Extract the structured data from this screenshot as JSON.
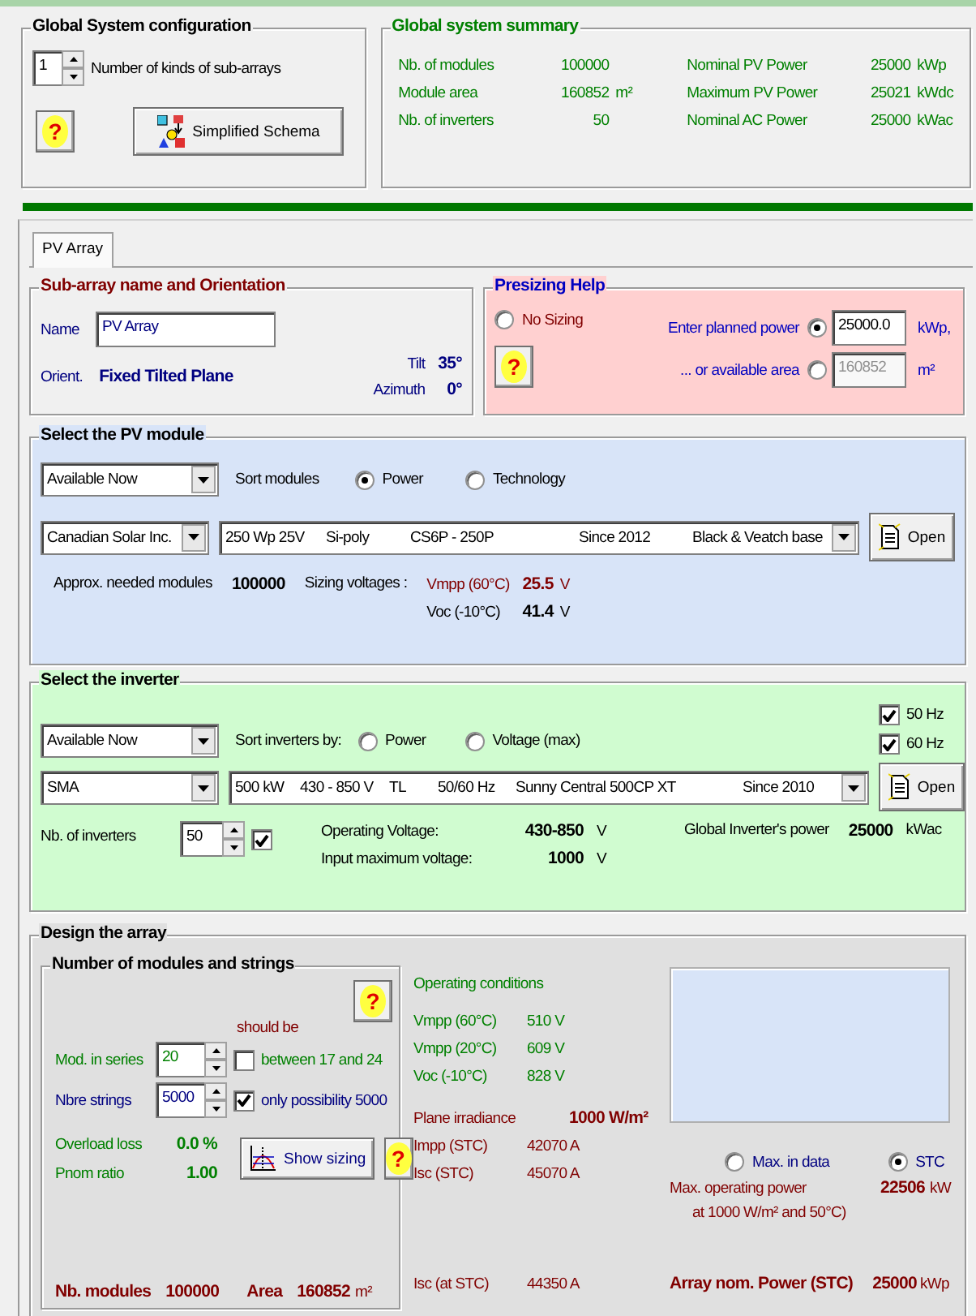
{
  "config": {
    "title": "Global System configuration",
    "subarray_count": "1",
    "subarray_label": "Number of kinds of sub-arrays",
    "help": "?",
    "schema_button": "Simplified Schema"
  },
  "summary": {
    "title": "Global system summary",
    "rows": [
      {
        "left": {
          "label": "Nb. of modules",
          "value": "100000"
        },
        "right": {
          "label": "Nominal PV Power",
          "value": "25000",
          "unit": "kWp"
        }
      },
      {
        "left": {
          "label": "Module area",
          "value": "160852",
          "unit": "m²"
        },
        "right": {
          "label": "Maximum PV Power",
          "value": "25021",
          "unit": "kWdc"
        }
      },
      {
        "left": {
          "label": "Nb. of inverters",
          "value": "50"
        },
        "right": {
          "label": "Nominal AC Power",
          "value": "25000",
          "unit": "kWac"
        }
      }
    ]
  },
  "tabs": [
    {
      "label": "PV Array",
      "selected": true
    }
  ],
  "orientation": {
    "title": "Sub-array name and Orientation",
    "name_label": "Name",
    "name_value": "PV Array",
    "orient_label": "Orient.",
    "orient_value": "Fixed Tilted Plane",
    "tilt_label": "Tilt",
    "tilt_value": "35°",
    "azimuth_label": "Azimuth",
    "azimuth_value": "0°"
  },
  "presizing": {
    "title": "Presizing Help",
    "help": "?",
    "options": [
      {
        "label": "No Sizing",
        "selected": false
      },
      {
        "label": "Enter planned power",
        "selected": true,
        "value": "25000.0",
        "unit": "kWp,"
      },
      {
        "label": "... or available area",
        "selected": false,
        "value": "160852",
        "unit": "m²"
      }
    ]
  },
  "module": {
    "title": "Select the PV module",
    "filter": "Available Now",
    "sort_label": "Sort modules",
    "sort_options": [
      {
        "label": "Power",
        "selected": true
      },
      {
        "label": "Technology",
        "selected": false
      }
    ],
    "manufacturer": "Canadian Solar Inc.",
    "model_fields": [
      "250 Wp 25V",
      "Si-poly",
      "CS6P - 250P",
      "Since 2012",
      "Black & Veatch base"
    ],
    "open_button": "Open",
    "needed_label": "Approx. needed modules",
    "needed_value": "100000",
    "voltages_label": "Sizing voltages :",
    "voltages": [
      {
        "label": "Vmpp (60°C)",
        "value": "25.5",
        "unit": "V",
        "kind": "warning"
      },
      {
        "label": "Voc (-10°C)",
        "value": "41.4",
        "unit": "V",
        "kind": "normal"
      }
    ]
  },
  "inverter": {
    "title": "Select the inverter",
    "filter": "Available Now",
    "sort_label": "Sort inverters by:",
    "sort_options": [
      {
        "label": "Power",
        "selected": false
      },
      {
        "label": "Voltage (max)",
        "selected": false
      }
    ],
    "frequencies": [
      {
        "label": "50 Hz",
        "checked": true
      },
      {
        "label": "60 Hz",
        "checked": true
      }
    ],
    "manufacturer": "SMA",
    "model_fields": [
      "500 kW",
      "430 - 850 V",
      "TL",
      "50/60 Hz",
      "Sunny Central 500CP XT",
      "Since 2010"
    ],
    "open_button": "Open",
    "count_label": "Nb. of inverters",
    "count_value": "50",
    "count_checked": true,
    "voltages": [
      {
        "label": "Operating Voltage:",
        "value": "430-850",
        "unit": "V"
      },
      {
        "label": "Input maximum voltage:",
        "value": "1000",
        "unit": "V"
      }
    ],
    "global_label": "Global Inverter's power",
    "global_value": "25000",
    "global_unit": "kWac"
  },
  "design": {
    "title": "Design the array",
    "strings_title": "Number of modules and strings",
    "help_buttons": [
      "?",
      "?"
    ],
    "should_be": "should be",
    "series": {
      "label": "Mod. in series",
      "value": "20",
      "checked": false,
      "note": "between 17 and 24"
    },
    "strings": {
      "label": "Nbre strings",
      "value": "5000",
      "checked": true,
      "note": "only possibility 5000"
    },
    "overload_label": "Overload loss",
    "overload_value": "0.0 %",
    "pnom_label": "Pnom ratio",
    "pnom_value": "1.00",
    "show_sizing": "Show sizing",
    "nb_label": "Nb. modules",
    "nb_value": "100000",
    "area_label": "Area",
    "area_value": "160852",
    "area_unit": "m²",
    "conditions_title": "Operating conditions",
    "conditions": [
      {
        "label": "Vmpp (60°C)",
        "value": "510 V"
      },
      {
        "label": "Vmpp (20°C)",
        "value": "609 V"
      },
      {
        "label": "Voc (-10°C)",
        "value": "828 V"
      }
    ],
    "irradiance_label": "Plane irradiance",
    "irradiance_value": "1000 W/m²",
    "currents": [
      {
        "label": "Impp (STC)",
        "value": "42070 A"
      },
      {
        "label": "Isc (STC)",
        "value": "45070 A"
      }
    ],
    "isc_label": "Isc (at STC)",
    "isc_value": "44350 A",
    "power_modes": [
      {
        "label": "Max. in data",
        "selected": false
      },
      {
        "label": "STC",
        "selected": true
      }
    ],
    "max_power_label": "Max. operating power",
    "max_power_value": "22506",
    "max_power_unit": "kW",
    "max_power_note": "at 1000 W/m² and 50°C)",
    "array_power_label": "Array nom. Power (STC)",
    "array_power_value": "25000",
    "array_power_unit": "kWp"
  }
}
